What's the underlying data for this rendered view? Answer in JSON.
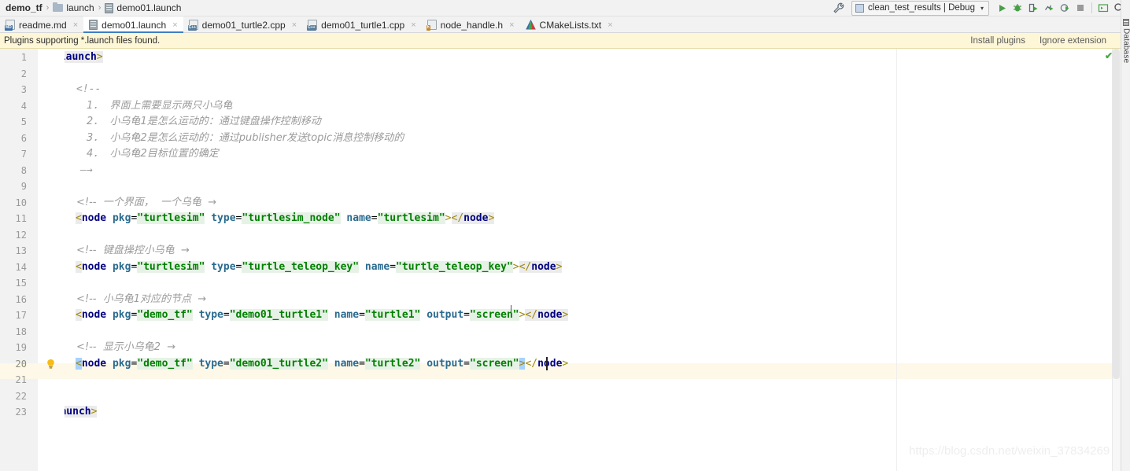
{
  "breadcrumb": {
    "project": "demo_tf",
    "folder": "launch",
    "file": "demo01.launch",
    "separator": "›"
  },
  "toolbar": {
    "run_config": "clean_test_results | Debug",
    "dropdown_arrow": "▾",
    "buttons": [
      {
        "name": "run-button",
        "label": "Run"
      },
      {
        "name": "debug-button",
        "label": "Debug"
      },
      {
        "name": "run-with-coverage-button",
        "label": "Run with Coverage"
      },
      {
        "name": "profile-button",
        "label": "Profile"
      },
      {
        "name": "attach-to-process-button",
        "label": "Attach to Process"
      },
      {
        "name": "stop-button",
        "label": "Stop"
      },
      {
        "name": "toggle-terminal-button",
        "label": "Terminal"
      },
      {
        "name": "search-everywhere-button",
        "label": "Search Everywhere"
      }
    ]
  },
  "tabs": [
    {
      "label": "readme.md",
      "icon": "markdown-file-icon",
      "badge": "MD",
      "active": false,
      "close": "×"
    },
    {
      "label": "demo01.launch",
      "icon": "launch-file-icon",
      "badge": "",
      "active": true,
      "close": "×"
    },
    {
      "label": "demo01_turtle2.cpp",
      "icon": "cpp-file-icon",
      "badge": "C++",
      "active": false,
      "close": "×"
    },
    {
      "label": "demo01_turtle1.cpp",
      "icon": "cpp-file-icon",
      "badge": "C++",
      "active": false,
      "close": "×"
    },
    {
      "label": "node_handle.h",
      "icon": "header-file-icon",
      "badge": "h",
      "active": false,
      "close": "×"
    },
    {
      "label": "CMakeLists.txt",
      "icon": "cmake-file-icon",
      "badge": "",
      "active": false,
      "close": "×"
    }
  ],
  "banner": {
    "message": "Plugins supporting *.launch files found.",
    "install_label": "Install plugins",
    "ignore_label": "Ignore extension"
  },
  "editor": {
    "current_line": 20,
    "inspection_status": "✔",
    "line_numbers": [
      1,
      2,
      3,
      4,
      5,
      6,
      7,
      8,
      9,
      10,
      11,
      12,
      13,
      14,
      15,
      16,
      17,
      18,
      19,
      20,
      21,
      22,
      23
    ],
    "code_lines": [
      {
        "n": 1,
        "type": "tag-open-root",
        "text": "<launch>"
      },
      {
        "n": 2,
        "type": "blank",
        "text": ""
      },
      {
        "n": 3,
        "type": "comment",
        "text": "<!--"
      },
      {
        "n": 4,
        "type": "comment",
        "text": "1. 界面上需要显示两只小乌龟"
      },
      {
        "n": 5,
        "type": "comment",
        "text": "2. 小乌龟1是怎么运动的：通过键盘操作控制移动"
      },
      {
        "n": 6,
        "type": "comment",
        "text": "3. 小乌龟2是怎么运动的：通过publisher发送topic消息控制移动的"
      },
      {
        "n": 7,
        "type": "comment",
        "text": "4. 小乌龟2目标位置的确定"
      },
      {
        "n": 8,
        "type": "comment",
        "text": "-->"
      },
      {
        "n": 9,
        "type": "blank",
        "text": ""
      },
      {
        "n": 10,
        "type": "comment",
        "text": "<!-- 一个界面， 一个乌龟 -->"
      },
      {
        "n": 11,
        "type": "node",
        "tag": "node",
        "attrs": [
          {
            "k": "pkg",
            "v": "turtlesim"
          },
          {
            "k": "type",
            "v": "turtlesim_node"
          },
          {
            "k": "name",
            "v": "turtlesim"
          }
        ]
      },
      {
        "n": 12,
        "type": "blank",
        "text": ""
      },
      {
        "n": 13,
        "type": "comment",
        "text": "<!-- 键盘操控小乌龟 -->"
      },
      {
        "n": 14,
        "type": "node",
        "tag": "node",
        "attrs": [
          {
            "k": "pkg",
            "v": "turtlesim"
          },
          {
            "k": "type",
            "v": "turtle_teleop_key"
          },
          {
            "k": "name",
            "v": "turtle_teleop_key"
          }
        ]
      },
      {
        "n": 15,
        "type": "blank",
        "text": ""
      },
      {
        "n": 16,
        "type": "comment",
        "text": "<!-- 小乌龟1对应的节点 -->"
      },
      {
        "n": 17,
        "type": "node",
        "tag": "node",
        "attrs": [
          {
            "k": "pkg",
            "v": "demo_tf"
          },
          {
            "k": "type",
            "v": "demo01_turtle1"
          },
          {
            "k": "name",
            "v": "turtle1"
          },
          {
            "k": "output",
            "v": "screen"
          }
        ]
      },
      {
        "n": 18,
        "type": "blank",
        "text": ""
      },
      {
        "n": 19,
        "type": "comment",
        "text": "<!-- 显示小乌龟2 -->"
      },
      {
        "n": 20,
        "type": "node",
        "tag": "node",
        "current": true,
        "attrs": [
          {
            "k": "pkg",
            "v": "demo_tf"
          },
          {
            "k": "type",
            "v": "demo01_turtle2"
          },
          {
            "k": "name",
            "v": "turtle2"
          },
          {
            "k": "output",
            "v": "screen"
          }
        ]
      },
      {
        "n": 21,
        "type": "blank",
        "text": ""
      },
      {
        "n": 22,
        "type": "blank",
        "text": ""
      },
      {
        "n": 23,
        "type": "tag-close-root",
        "text": "</launch>"
      }
    ],
    "text": {
      "l1": "<launch>",
      "l3": "<!--",
      "l4": "1．  界面上需要显示两只小乌龟",
      "l5": "2．  小乌龟1是怎么运动的：通过键盘操作控制移动",
      "l6": "3．  小乌龟2是怎么运动的：通过publisher发送topic消息控制移动的",
      "l7": "4．  小乌龟2目标位置的确定",
      "l8": "—→",
      "l10": "<!--  一个界面，  一个乌龟  →",
      "l13": "<!--  键盘操控小乌龟  →",
      "l16": "<!--  小乌龟1对应的节点  →",
      "l19": "<!--  显示小乌龟2  →",
      "l23": "</launch>",
      "lt_open": "<",
      "lt_close": "</",
      "gt": ">",
      "tag_launch": "launch",
      "tag_node": "node",
      "eq": "=",
      "quote": "\"",
      "close_node": "</node>",
      "attr_pkg": "pkg",
      "attr_type": "type",
      "attr_name": "name",
      "attr_output": "output",
      "v_turtlesim": "turtlesim",
      "v_turtlesim_node": "turtlesim_node",
      "v_turtle_teleop_key": "turtle_teleop_key",
      "v_demo_tf": "demo_tf",
      "v_demo01_turtle1": "demo01_turtle1",
      "v_demo01_turtle2": "demo01_turtle2",
      "v_turtle1": "turtle1",
      "v_turtle2": "turtle2",
      "v_screen": "screen"
    },
    "intention_bulb": "lightbulb-icon"
  },
  "right_tool_window": {
    "label": "Database",
    "icon": "database-icon"
  },
  "watermark": "https://blog.csdn.net/weixin_37834269",
  "colors": {
    "accent_tab": "#3d7fc1",
    "banner_bg": "#fdf6d7",
    "current_line": "#fdf8e8",
    "tag_bracket": "#9e880d",
    "tag_name": "#000080",
    "attr_name": "#2a6b8f",
    "attr_value": "#008000",
    "comment": "#9b9b9b",
    "run_green": "#4a9e49"
  }
}
